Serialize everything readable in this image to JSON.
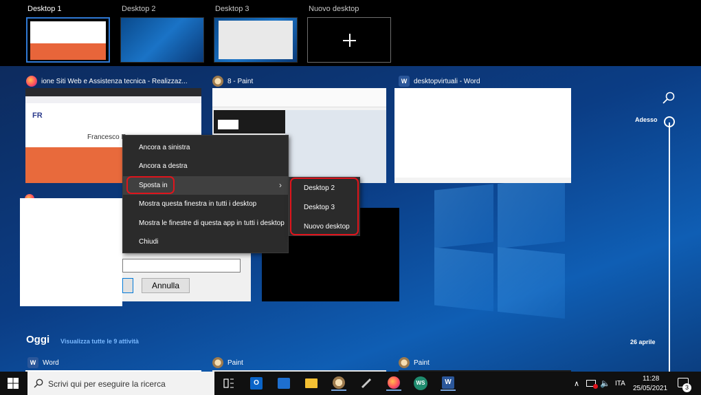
{
  "desktops": [
    {
      "label": "Desktop 1",
      "active": true
    },
    {
      "label": "Desktop 2",
      "active": false
    },
    {
      "label": "Desktop 3",
      "active": false
    },
    {
      "label": "Nuovo desktop",
      "active": false
    }
  ],
  "windows": {
    "firefox_title": "ione Siti Web e Assistenza tecnica - Realizzaz...",
    "paint_title": "8 - Paint",
    "word_title": "desktopvirtuali - Word",
    "firefox_page_heading": "Francesco R",
    "dialog_cancel": "Annulla"
  },
  "context_menu": {
    "items": [
      "Ancora a sinistra",
      "Ancora a destra",
      "Sposta in",
      "Mostra questa finestra in tutti i desktop",
      "Mostra le finestre di questa app in tutti i desktop",
      "Chiudi"
    ],
    "submenu": [
      "Desktop 2",
      "Desktop 3",
      "Nuovo desktop"
    ]
  },
  "timeline": {
    "now_label": "Adesso",
    "date_label": "26 aprile",
    "today_heading": "Oggi",
    "view_all_link": "Visualizza tutte le 9 attività",
    "activities": [
      "Word",
      "Paint",
      "Paint"
    ]
  },
  "taskbar": {
    "search_placeholder": "Scrivi qui per eseguire la ricerca",
    "language": "ITA",
    "time": "11:28",
    "date": "25/05/2021",
    "notifications": "3"
  },
  "colors": {
    "accent": "#2f7ad6",
    "highlight_ring": "#e0141c",
    "menu_bg": "#2b2b2b"
  }
}
